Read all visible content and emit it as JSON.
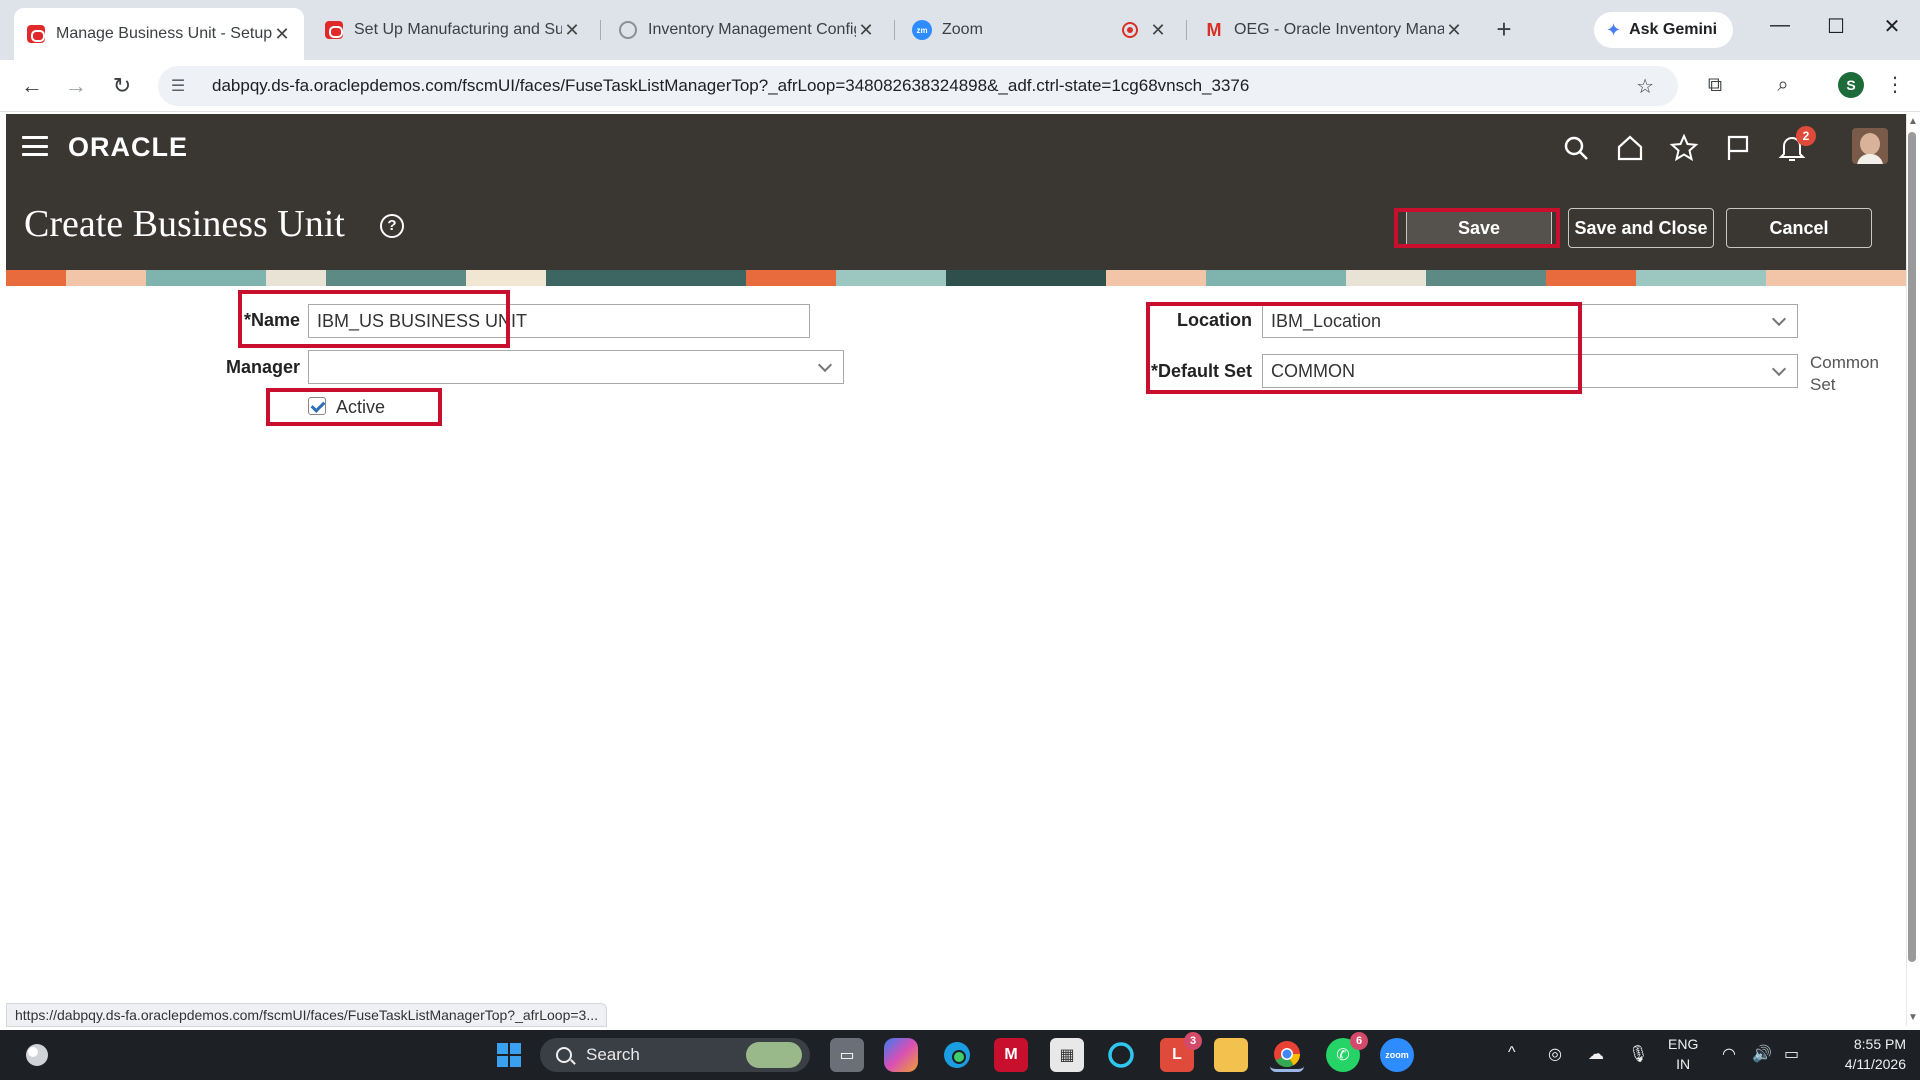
{
  "browser": {
    "tabs": [
      {
        "title": "Manage Business Unit - Setup",
        "favicon": "oracle-icon",
        "active": true
      },
      {
        "title": "Set Up Manufacturing and Sup",
        "favicon": "oracle-icon",
        "active": false
      },
      {
        "title": "Inventory Management Config",
        "favicon": "globe-icon",
        "active": false
      },
      {
        "title": "Zoom",
        "favicon": "zoom-icon",
        "active": false
      },
      {
        "title": "OEG - Oracle Inventory Manag",
        "favicon": "gmail-icon",
        "active": false
      }
    ],
    "zoom_favicon_text": "zm",
    "gemini_label": "Ask Gemini",
    "url": "dabpqy.ds-fa.oraclepdemos.com/fscmUI/faces/FuseTaskListManagerTop?_afrLoop=348082638324898&_adf.ctrl-state=1cg68vnsch_3376",
    "profile_initial": "S",
    "status_url": "https://dabpqy.ds-fa.oraclepdemos.com/fscmUI/faces/FuseTaskListManagerTop?_afrLoop=3..."
  },
  "app": {
    "logo": "ORACLE",
    "notification_count": "2",
    "page_title": "Create Business Unit",
    "help_glyph": "?",
    "buttons": {
      "save": "Save",
      "save_close": "Save and Close",
      "cancel": "Cancel"
    }
  },
  "form": {
    "name_label": "Name",
    "name_value": "IBM_US BUSINESS UNIT",
    "manager_label": "Manager",
    "manager_value": "",
    "active_label": "Active",
    "active_checked": true,
    "location_label": "Location",
    "location_value": "IBM_Location",
    "default_set_label": "Default Set",
    "default_set_value": "COMMON",
    "default_set_hint": "Common Set",
    "required_marker": "*"
  },
  "taskbar": {
    "search_label": "Search",
    "badges": {
      "office_l": "3",
      "whatsapp": "6"
    },
    "lang_primary": "ENG",
    "lang_secondary": "IN",
    "time": "8:55 PM",
    "date": "4/11/2026"
  },
  "colors": {
    "oracle_header": "#3a3733",
    "highlight_red": "#c8102e",
    "check_blue": "#2c6fb5"
  }
}
